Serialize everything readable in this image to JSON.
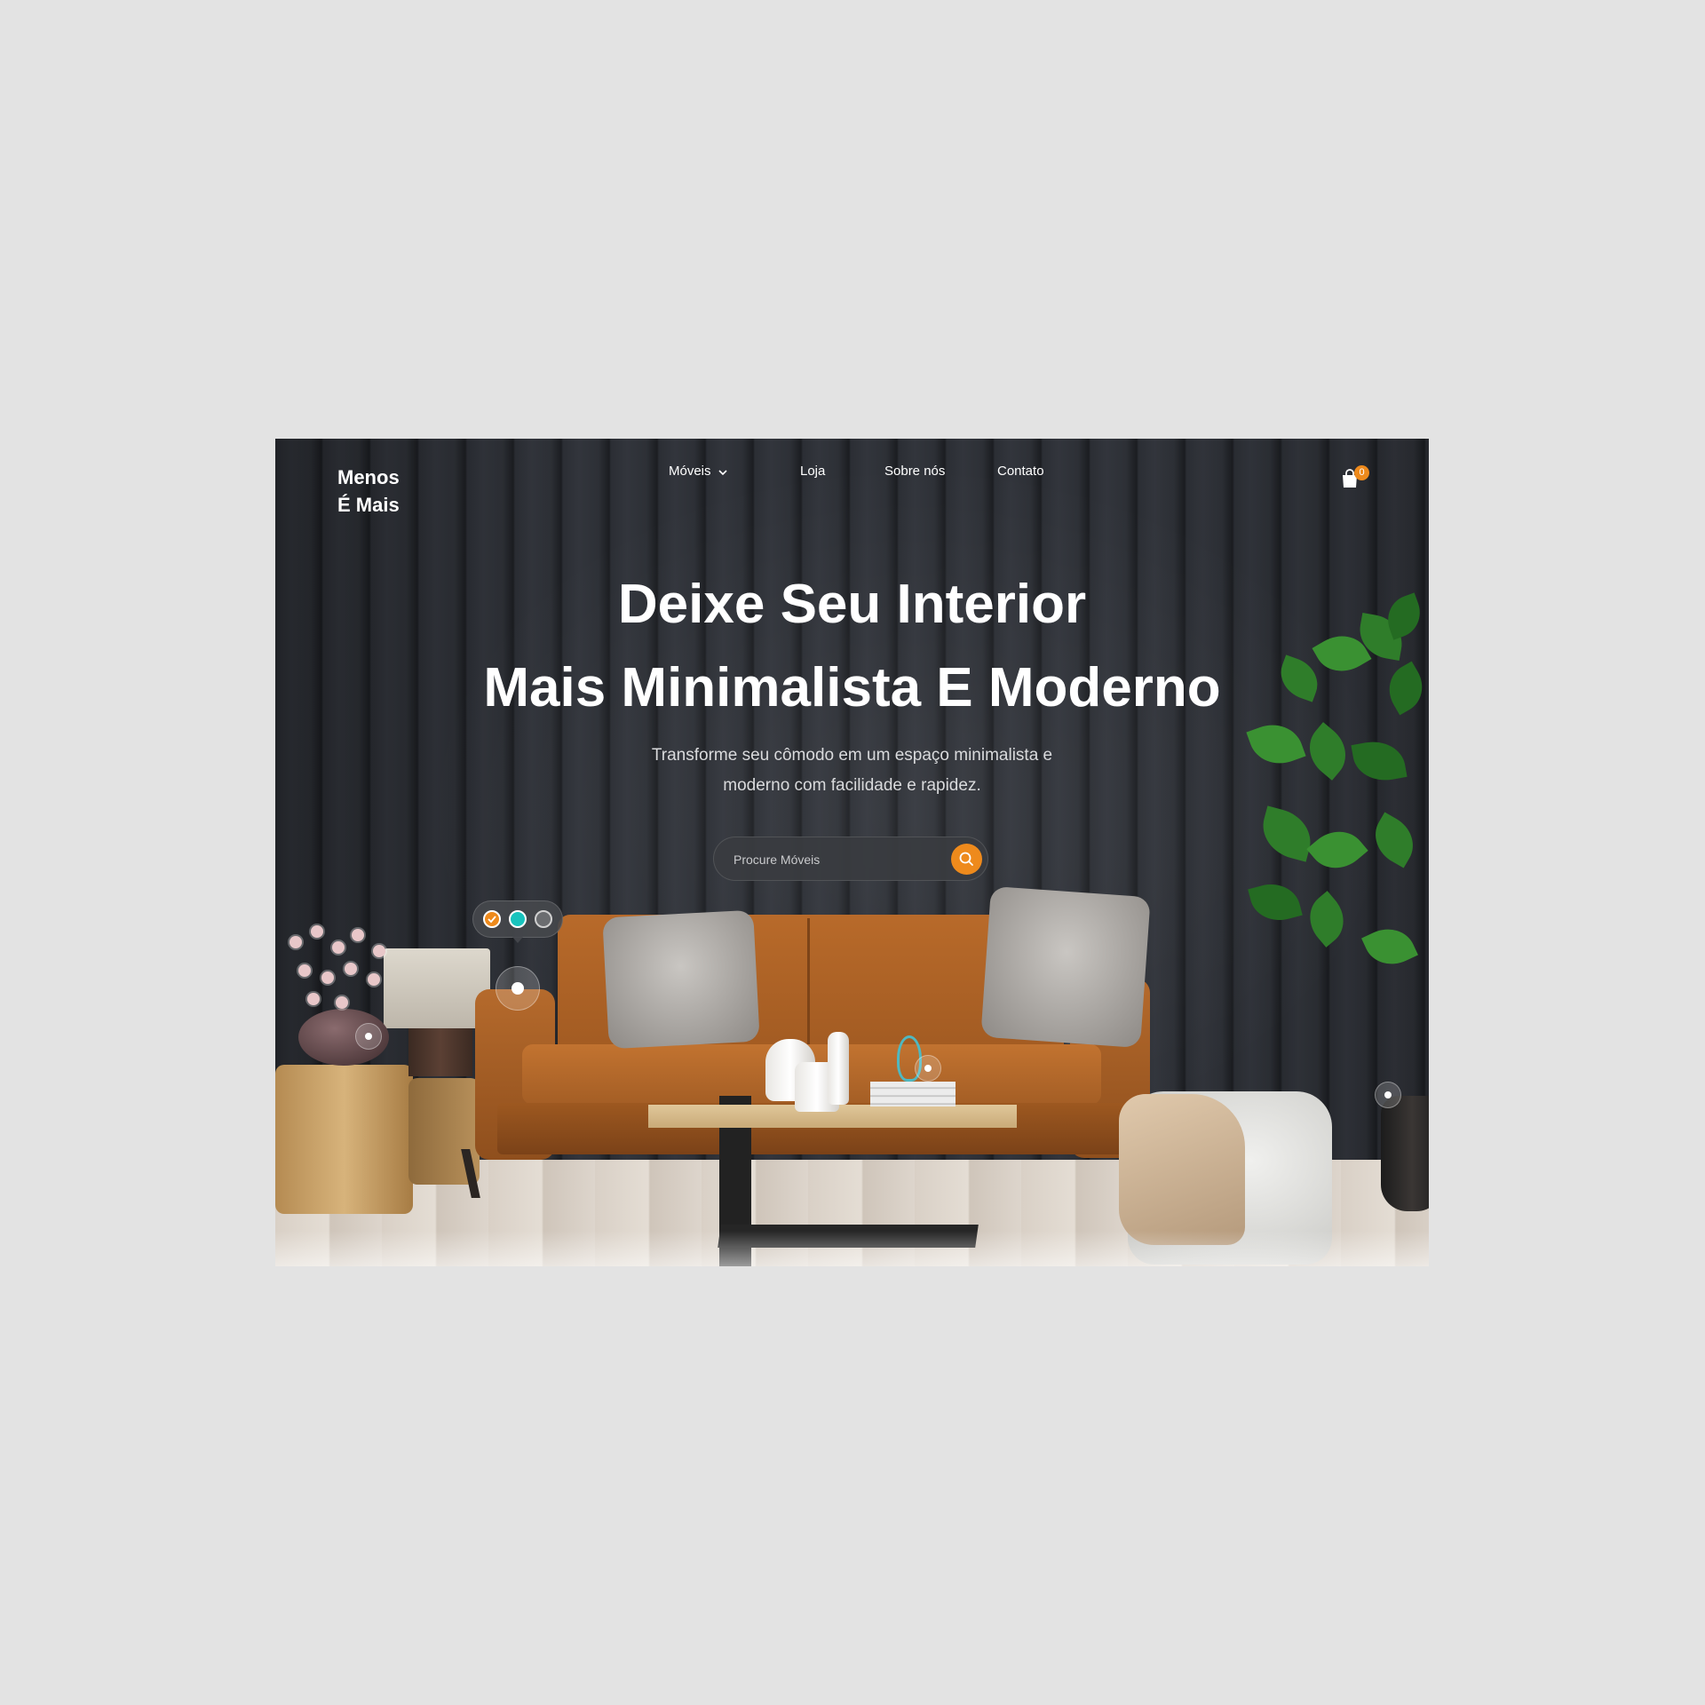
{
  "brand": {
    "logo_text": "Menos\nÉ Mais"
  },
  "nav": {
    "items": [
      {
        "label": "Móveis",
        "has_dropdown": true
      },
      {
        "label": "Loja"
      },
      {
        "label": "Sobre nós"
      },
      {
        "label": "Contato"
      }
    ],
    "cart": {
      "icon": "shopping-bag-icon",
      "count": "0"
    }
  },
  "hero": {
    "title_line1": "Deixe Seu Interior",
    "title_line2": "Mais Minimalista E Moderno",
    "subtitle_line1": "Transforme seu cômodo em um espaço minimalista e",
    "subtitle_line2": "moderno com facilidade e rapidez."
  },
  "search": {
    "placeholder": "Procure Móveis",
    "button_icon": "search-icon"
  },
  "color_picker": {
    "swatches": [
      {
        "color": "#ee8a1c",
        "selected": true
      },
      {
        "color": "#18c3bd",
        "selected": false
      },
      {
        "color": "#6b6d70",
        "selected": false
      }
    ]
  },
  "colors": {
    "accent": "#ee8a1c",
    "wall": "#2b2e34",
    "sofa": "#b0642a"
  }
}
